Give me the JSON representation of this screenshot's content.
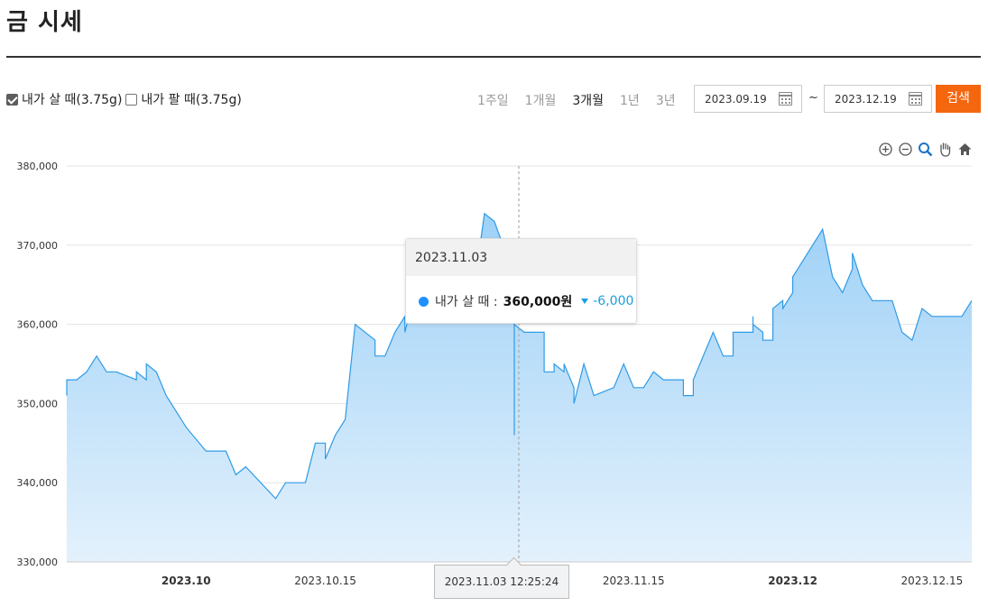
{
  "page": {
    "title": "금 시세"
  },
  "filters": {
    "buy_label": "내가 살 때(3.75g)",
    "sell_label": "내가 팔 때(3.75g)",
    "buy_checked": true,
    "sell_checked": false
  },
  "periods": [
    {
      "label": "1주일",
      "active": false
    },
    {
      "label": "1개월",
      "active": false
    },
    {
      "label": "3개월",
      "active": true
    },
    {
      "label": "1년",
      "active": false
    },
    {
      "label": "3년",
      "active": false
    }
  ],
  "date_range": {
    "start": "2023.09.19",
    "separator": "~",
    "end": "2023.12.19",
    "search_label": "검색"
  },
  "toolbar": [
    "zoom-in-icon",
    "zoom-out-icon",
    "zoom-select-icon",
    "pan-hand-icon",
    "home-icon"
  ],
  "tooltip": {
    "date": "2023.11.03",
    "series_name": "내가 살 때 :",
    "value": "360,000원",
    "change": "-6,000"
  },
  "crosshair_label": "2023.11.03 12:25:24",
  "colors": {
    "line": "#2e9be6",
    "fill_top": "#9ed1f7",
    "fill_bottom": "#e3f1fc",
    "accent": "#f4670f",
    "grid": "#e3e3e3"
  },
  "chart_data": {
    "type": "area",
    "title": "",
    "xlabel": "",
    "ylabel": "",
    "ylim": [
      330000,
      380000
    ],
    "y_ticks": [
      "330,000",
      "340,000",
      "350,000",
      "360,000",
      "370,000",
      "380,000"
    ],
    "x_ticks": [
      {
        "label": "2023.10",
        "date": "2023-10-01",
        "bold": true
      },
      {
        "label": "2023.10.15",
        "date": "2023-10-15",
        "bold": false
      },
      {
        "label": "2023.11.15",
        "date": "2023-11-15",
        "bold": false
      },
      {
        "label": "2023.12",
        "date": "2023-12-01",
        "bold": true
      },
      {
        "label": "2023.12.15",
        "date": "2023-12-15",
        "bold": false
      }
    ],
    "xlim": [
      "2023-09-19",
      "2023-12-19"
    ],
    "series": [
      {
        "name": "내가 살 때",
        "points": [
          [
            "2023-09-19",
            351000
          ],
          [
            "2023-09-19",
            353000
          ],
          [
            "2023-09-20",
            353000
          ],
          [
            "2023-09-21",
            354000
          ],
          [
            "2023-09-22",
            356000
          ],
          [
            "2023-09-23",
            354000
          ],
          [
            "2023-09-24",
            354000
          ],
          [
            "2023-09-26",
            353000
          ],
          [
            "2023-09-26",
            354000
          ],
          [
            "2023-09-27",
            353000
          ],
          [
            "2023-09-27",
            355000
          ],
          [
            "2023-09-28",
            354000
          ],
          [
            "2023-09-29",
            351000
          ],
          [
            "2023-10-01",
            347000
          ],
          [
            "2023-10-03",
            344000
          ],
          [
            "2023-10-05",
            344000
          ],
          [
            "2023-10-06",
            341000
          ],
          [
            "2023-10-07",
            342000
          ],
          [
            "2023-10-10",
            338000
          ],
          [
            "2023-10-11",
            340000
          ],
          [
            "2023-10-13",
            340000
          ],
          [
            "2023-10-14",
            345000
          ],
          [
            "2023-10-15",
            345000
          ],
          [
            "2023-10-15",
            343000
          ],
          [
            "2023-10-16",
            346000
          ],
          [
            "2023-10-17",
            348000
          ],
          [
            "2023-10-18",
            360000
          ],
          [
            "2023-10-20",
            358000
          ],
          [
            "2023-10-20",
            356000
          ],
          [
            "2023-10-21",
            356000
          ],
          [
            "2023-10-22",
            359000
          ],
          [
            "2023-10-23",
            361000
          ],
          [
            "2023-10-23",
            359000
          ],
          [
            "2023-10-24",
            364000
          ],
          [
            "2023-10-25",
            368000
          ],
          [
            "2023-10-25",
            367000
          ],
          [
            "2023-10-26",
            367000
          ],
          [
            "2023-10-30",
            365000
          ],
          [
            "2023-10-31",
            374000
          ],
          [
            "2023-11-01",
            373000
          ],
          [
            "2023-11-03",
            366000
          ],
          [
            "2023-11-03",
            346000
          ],
          [
            "2023-11-03",
            360000
          ],
          [
            "2023-11-04",
            359000
          ],
          [
            "2023-11-06",
            359000
          ],
          [
            "2023-11-06",
            355000
          ],
          [
            "2023-11-06",
            354000
          ],
          [
            "2023-11-07",
            354000
          ],
          [
            "2023-11-07",
            355000
          ],
          [
            "2023-11-08",
            354000
          ],
          [
            "2023-11-08",
            355000
          ],
          [
            "2023-11-09",
            352000
          ],
          [
            "2023-11-09",
            350000
          ],
          [
            "2023-11-10",
            355000
          ],
          [
            "2023-11-11",
            351000
          ],
          [
            "2023-11-13",
            352000
          ],
          [
            "2023-11-14",
            355000
          ],
          [
            "2023-11-15",
            352000
          ],
          [
            "2023-11-16",
            352000
          ],
          [
            "2023-11-17",
            354000
          ],
          [
            "2023-11-18",
            353000
          ],
          [
            "2023-11-20",
            353000
          ],
          [
            "2023-11-20",
            351000
          ],
          [
            "2023-11-21",
            351000
          ],
          [
            "2023-11-21",
            353000
          ],
          [
            "2023-11-22",
            356000
          ],
          [
            "2023-11-23",
            359000
          ],
          [
            "2023-11-24",
            356000
          ],
          [
            "2023-11-25",
            356000
          ],
          [
            "2023-11-25",
            359000
          ],
          [
            "2023-11-27",
            359000
          ],
          [
            "2023-11-27",
            361000
          ],
          [
            "2023-11-27",
            360000
          ],
          [
            "2023-11-28",
            359000
          ],
          [
            "2023-11-28",
            358000
          ],
          [
            "2023-11-29",
            358000
          ],
          [
            "2023-11-29",
            362000
          ],
          [
            "2023-11-30",
            363000
          ],
          [
            "2023-11-30",
            362000
          ],
          [
            "2023-12-01",
            364000
          ],
          [
            "2023-12-01",
            366000
          ],
          [
            "2023-12-02",
            368000
          ],
          [
            "2023-12-04",
            372000
          ],
          [
            "2023-12-05",
            366000
          ],
          [
            "2023-12-06",
            364000
          ],
          [
            "2023-12-07",
            367000
          ],
          [
            "2023-12-07",
            369000
          ],
          [
            "2023-12-08",
            365000
          ],
          [
            "2023-12-09",
            363000
          ],
          [
            "2023-12-11",
            363000
          ],
          [
            "2023-12-12",
            359000
          ],
          [
            "2023-12-13",
            358000
          ],
          [
            "2023-12-14",
            362000
          ],
          [
            "2023-12-15",
            361000
          ],
          [
            "2023-12-17",
            361000
          ],
          [
            "2023-12-18",
            361000
          ],
          [
            "2023-12-19",
            363000
          ]
        ]
      }
    ],
    "grid": true,
    "legend": "none",
    "crosshair": {
      "date": "2023-11-03",
      "value": 360000
    }
  }
}
